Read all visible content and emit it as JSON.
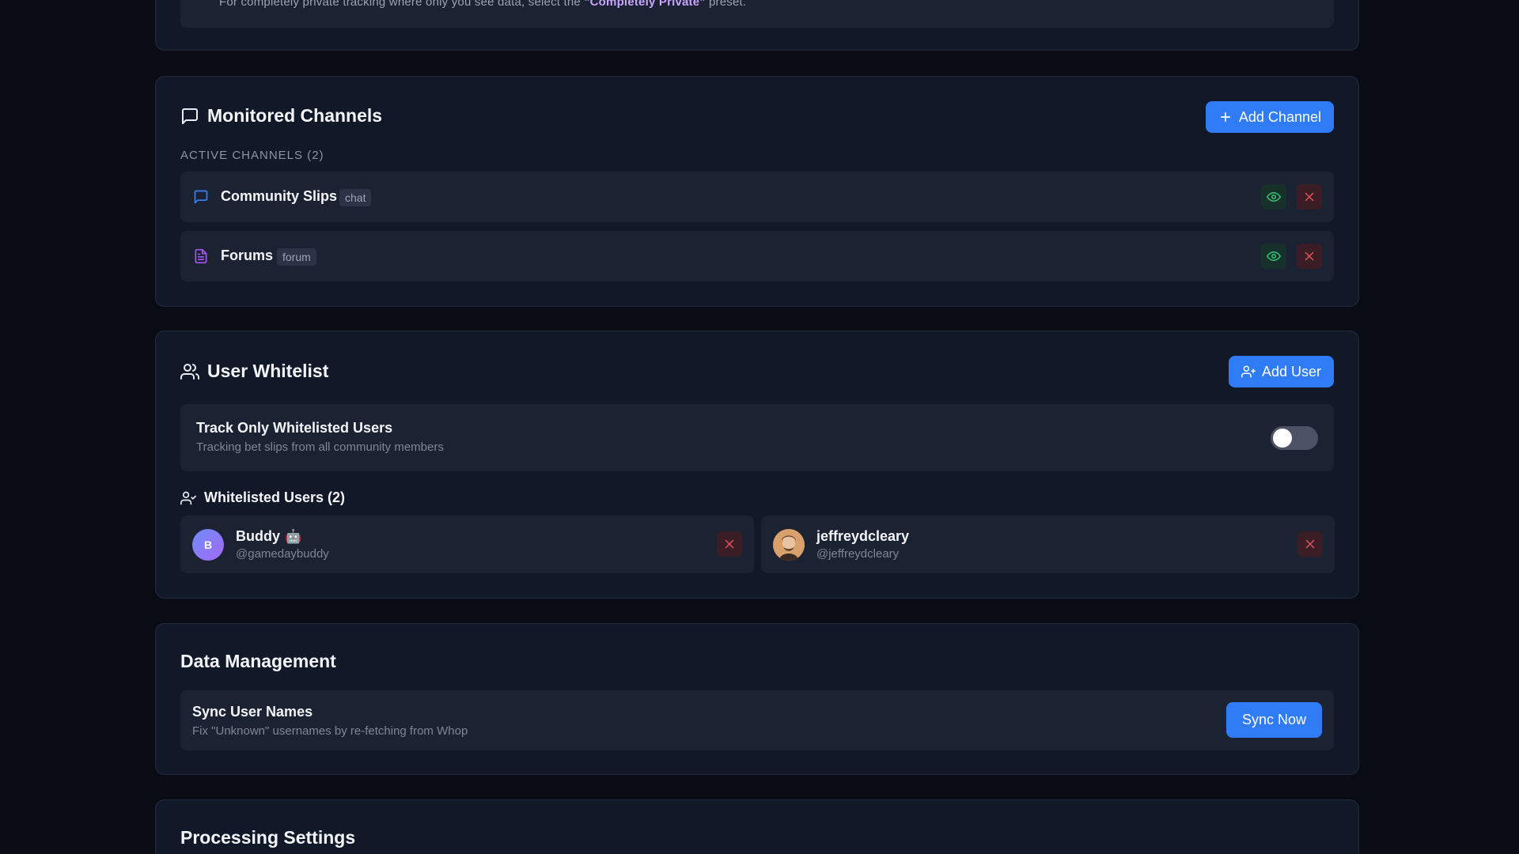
{
  "privacy_note": {
    "prefix": "For completely private tracking where only you see data, select the ",
    "highlight": "\"Completely Private\"",
    "suffix": " preset."
  },
  "channels": {
    "title": "Monitored Channels",
    "add_button": "Add Channel",
    "section_label": "ACTIVE CHANNELS (2)",
    "items": [
      {
        "name": "Community Slips",
        "type": "chat",
        "icon": "chat-bubble-icon"
      },
      {
        "name": "Forums",
        "type": "forum",
        "icon": "document-icon"
      }
    ]
  },
  "whitelist": {
    "title": "User Whitelist",
    "add_button": "Add User",
    "toggle": {
      "title": "Track Only Whitelisted Users",
      "subtitle": "Tracking bet slips from all community members",
      "enabled": false
    },
    "list_label": "Whitelisted Users (2)",
    "users": [
      {
        "name": "Buddy",
        "emoji": "🤖",
        "handle": "@gamedaybuddy",
        "avatar_initial": "B"
      },
      {
        "name": "jeffreydcleary",
        "emoji": "",
        "handle": "@jeffreydcleary",
        "avatar_initial": ""
      }
    ]
  },
  "data_management": {
    "title": "Data Management",
    "sync": {
      "title": "Sync User Names",
      "subtitle": "Fix \"Unknown\" usernames by re-fetching from Whop",
      "button": "Sync Now"
    }
  },
  "processing": {
    "title": "Processing Settings"
  },
  "colors": {
    "accent": "#2f7cf6",
    "background": "#090c14",
    "card": "#111827",
    "danger": "#e0525e",
    "success": "#34c77b"
  }
}
